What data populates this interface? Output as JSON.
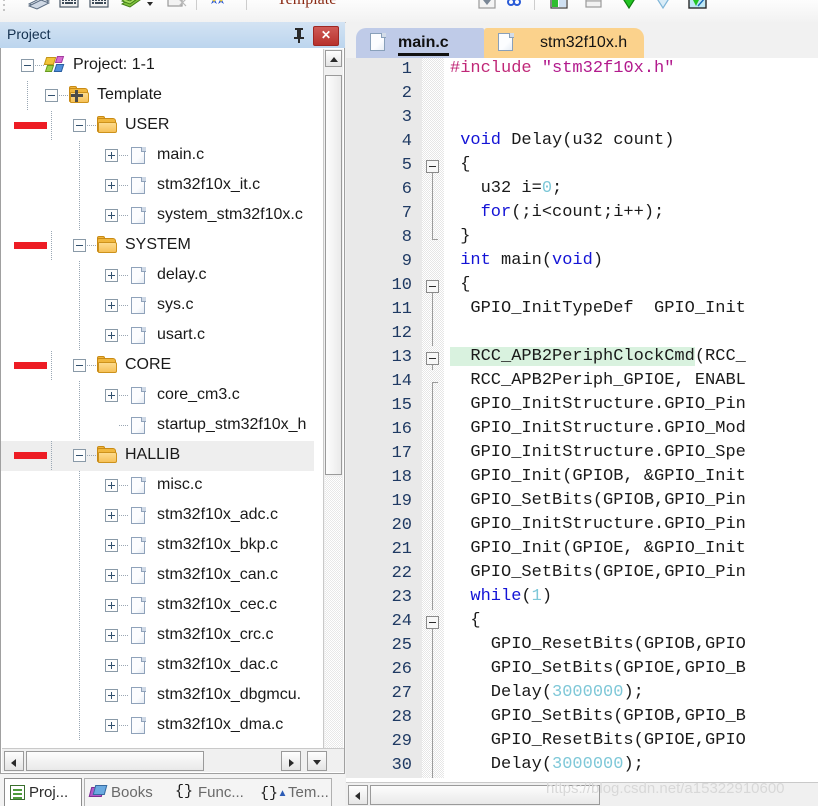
{
  "toolbar": {
    "template_label": "Template",
    "icons": [
      "books-icon",
      "keyboard-icon",
      "keyboard-icon-2",
      "build-icon",
      "clear-icon",
      "bookmark-icon",
      "dropdown-icon",
      "find-icon",
      "window-icon",
      "panel-icon",
      "download-icon",
      "filter-icon",
      "debug-icon"
    ]
  },
  "project_panel": {
    "title": "Project",
    "pin_label": "↯",
    "close_label": "✕",
    "tree": [
      {
        "label": "Project: 1-1",
        "depth": 0,
        "icon": "project-icon",
        "expander": "minus",
        "redmark": false,
        "selected": false
      },
      {
        "label": "Template",
        "depth": 1,
        "icon": "folder-icon",
        "expander": "minus",
        "redmark": false,
        "selected": false
      },
      {
        "label": "USER",
        "depth": 2,
        "icon": "folder-icon",
        "expander": "minus",
        "redmark": true,
        "selected": false
      },
      {
        "label": "main.c",
        "depth": 3,
        "icon": "file-icon",
        "expander": "plus",
        "redmark": false,
        "selected": false
      },
      {
        "label": "stm32f10x_it.c",
        "depth": 3,
        "icon": "file-icon",
        "expander": "plus",
        "redmark": false,
        "selected": false
      },
      {
        "label": "system_stm32f10x.c",
        "depth": 3,
        "icon": "file-icon",
        "expander": "plus",
        "redmark": false,
        "selected": false
      },
      {
        "label": "SYSTEM",
        "depth": 2,
        "icon": "folder-icon",
        "expander": "minus",
        "redmark": true,
        "selected": false
      },
      {
        "label": "delay.c",
        "depth": 3,
        "icon": "file-icon",
        "expander": "plus",
        "redmark": false,
        "selected": false
      },
      {
        "label": "sys.c",
        "depth": 3,
        "icon": "file-icon",
        "expander": "plus",
        "redmark": false,
        "selected": false
      },
      {
        "label": "usart.c",
        "depth": 3,
        "icon": "file-icon",
        "expander": "plus",
        "redmark": false,
        "selected": false
      },
      {
        "label": "CORE",
        "depth": 2,
        "icon": "folder-icon",
        "expander": "minus",
        "redmark": true,
        "selected": false
      },
      {
        "label": "core_cm3.c",
        "depth": 3,
        "icon": "file-icon",
        "expander": "plus",
        "redmark": false,
        "selected": false
      },
      {
        "label": "startup_stm32f10x_h",
        "depth": 3,
        "icon": "file-icon",
        "expander": "none",
        "redmark": false,
        "selected": false
      },
      {
        "label": "HALLIB",
        "depth": 2,
        "icon": "folder-icon",
        "expander": "minus",
        "redmark": true,
        "selected": true
      },
      {
        "label": "misc.c",
        "depth": 3,
        "icon": "file-icon",
        "expander": "plus",
        "redmark": false,
        "selected": false
      },
      {
        "label": "stm32f10x_adc.c",
        "depth": 3,
        "icon": "file-icon",
        "expander": "plus",
        "redmark": false,
        "selected": false
      },
      {
        "label": "stm32f10x_bkp.c",
        "depth": 3,
        "icon": "file-icon",
        "expander": "plus",
        "redmark": false,
        "selected": false
      },
      {
        "label": "stm32f10x_can.c",
        "depth": 3,
        "icon": "file-icon",
        "expander": "plus",
        "redmark": false,
        "selected": false
      },
      {
        "label": "stm32f10x_cec.c",
        "depth": 3,
        "icon": "file-icon",
        "expander": "plus",
        "redmark": false,
        "selected": false
      },
      {
        "label": "stm32f10x_crc.c",
        "depth": 3,
        "icon": "file-icon",
        "expander": "plus",
        "redmark": false,
        "selected": false
      },
      {
        "label": "stm32f10x_dac.c",
        "depth": 3,
        "icon": "file-icon",
        "expander": "plus",
        "redmark": false,
        "selected": false
      },
      {
        "label": "stm32f10x_dbgmcu.",
        "depth": 3,
        "icon": "file-icon",
        "expander": "plus",
        "redmark": false,
        "selected": false
      },
      {
        "label": "stm32f10x_dma.c",
        "depth": 3,
        "icon": "file-icon",
        "expander": "plus",
        "redmark": false,
        "selected": false
      }
    ]
  },
  "bottom_tabs": [
    {
      "label": "Proj...",
      "icon": "project-window-icon",
      "active": true
    },
    {
      "label": "Books",
      "icon": "books-icon",
      "active": false
    },
    {
      "label": "Func...",
      "icon": "braces-icon",
      "active": false
    },
    {
      "label": "Tem...",
      "icon": "templates-icon",
      "active": false
    }
  ],
  "editor": {
    "tabs": [
      {
        "label": "main.c",
        "active": true,
        "color": "#bfcbe8"
      },
      {
        "label": "stm32f10x.h",
        "active": false,
        "color": "#fbd28c"
      }
    ],
    "lines": [
      {
        "n": "1",
        "segments": [
          {
            "t": "#include ",
            "c": "pp"
          },
          {
            "t": "\"stm32f10x.h\"",
            "c": "str"
          }
        ],
        "fold": "none",
        "highlight": false
      },
      {
        "n": "2",
        "segments": [
          {
            "t": "",
            "c": ""
          }
        ],
        "fold": "none",
        "highlight": false
      },
      {
        "n": "3",
        "segments": [
          {
            "t": "",
            "c": ""
          }
        ],
        "fold": "none",
        "highlight": false
      },
      {
        "n": "4",
        "segments": [
          {
            "t": " ",
            "c": ""
          },
          {
            "t": "void",
            "c": "kw"
          },
          {
            "t": " Delay(u32 count)",
            "c": ""
          }
        ],
        "fold": "none",
        "highlight": false
      },
      {
        "n": "5",
        "segments": [
          {
            "t": " {",
            "c": ""
          }
        ],
        "fold": "start",
        "highlight": false
      },
      {
        "n": "6",
        "segments": [
          {
            "t": "   u32 i=",
            "c": ""
          },
          {
            "t": "0",
            "c": "num"
          },
          {
            "t": ";",
            "c": ""
          }
        ],
        "fold": "bar",
        "highlight": false
      },
      {
        "n": "7",
        "segments": [
          {
            "t": "   ",
            "c": ""
          },
          {
            "t": "for",
            "c": "kw"
          },
          {
            "t": "(;i<count;i++);",
            "c": ""
          }
        ],
        "fold": "bar",
        "highlight": false
      },
      {
        "n": "8",
        "segments": [
          {
            "t": " }",
            "c": ""
          }
        ],
        "fold": "end",
        "highlight": false
      },
      {
        "n": "9",
        "segments": [
          {
            "t": " ",
            "c": ""
          },
          {
            "t": "int",
            "c": "kw"
          },
          {
            "t": " main(",
            "c": ""
          },
          {
            "t": "void",
            "c": "kw"
          },
          {
            "t": ")",
            "c": ""
          }
        ],
        "fold": "none",
        "highlight": false
      },
      {
        "n": "10",
        "segments": [
          {
            "t": " {",
            "c": ""
          }
        ],
        "fold": "start",
        "highlight": false
      },
      {
        "n": "11",
        "segments": [
          {
            "t": "  GPIO_InitTypeDef  GPIO_Init",
            "c": ""
          }
        ],
        "fold": "bar",
        "highlight": false
      },
      {
        "n": "12",
        "segments": [
          {
            "t": "",
            "c": ""
          }
        ],
        "fold": "bar",
        "highlight": false
      },
      {
        "n": "13",
        "segments": [
          {
            "t": "  RCC_APB2PeriphClockCmd",
            "c": "hl"
          },
          {
            "t": "(RCC_",
            "c": ""
          }
        ],
        "fold": "start2",
        "highlight": true
      },
      {
        "n": "14",
        "segments": [
          {
            "t": "  RCC_APB2Periph_GPIOE, ENABL",
            "c": ""
          }
        ],
        "fold": "tick",
        "highlight": false
      },
      {
        "n": "15",
        "segments": [
          {
            "t": "  GPIO_InitStructure.GPIO_Pin",
            "c": ""
          }
        ],
        "fold": "bar",
        "highlight": false
      },
      {
        "n": "16",
        "segments": [
          {
            "t": "  GPIO_InitStructure.GPIO_Mod",
            "c": ""
          }
        ],
        "fold": "bar",
        "highlight": false
      },
      {
        "n": "17",
        "segments": [
          {
            "t": "  GPIO_InitStructure.GPIO_Spe",
            "c": ""
          }
        ],
        "fold": "bar",
        "highlight": false
      },
      {
        "n": "18",
        "segments": [
          {
            "t": "  GPIO_Init(GPIOB, &GPIO_Init",
            "c": ""
          }
        ],
        "fold": "bar",
        "highlight": false
      },
      {
        "n": "19",
        "segments": [
          {
            "t": "  GPIO_SetBits(GPIOB,GPIO_Pin",
            "c": ""
          }
        ],
        "fold": "bar",
        "highlight": false
      },
      {
        "n": "20",
        "segments": [
          {
            "t": "  GPIO_InitStructure.GPIO_Pin",
            "c": ""
          }
        ],
        "fold": "bar",
        "highlight": false
      },
      {
        "n": "21",
        "segments": [
          {
            "t": "  GPIO_Init(GPIOE, &GPIO_Init",
            "c": ""
          }
        ],
        "fold": "bar",
        "highlight": false
      },
      {
        "n": "22",
        "segments": [
          {
            "t": "  GPIO_SetBits(GPIOE,GPIO_Pin",
            "c": ""
          }
        ],
        "fold": "bar",
        "highlight": false
      },
      {
        "n": "23",
        "segments": [
          {
            "t": "  ",
            "c": ""
          },
          {
            "t": "while",
            "c": "kw"
          },
          {
            "t": "(",
            "c": ""
          },
          {
            "t": "1",
            "c": "num"
          },
          {
            "t": ")",
            "c": ""
          }
        ],
        "fold": "bar",
        "highlight": false
      },
      {
        "n": "24",
        "segments": [
          {
            "t": "  {",
            "c": ""
          }
        ],
        "fold": "start",
        "highlight": false
      },
      {
        "n": "25",
        "segments": [
          {
            "t": "    GPIO_ResetBits(GPIOB,GPIO",
            "c": ""
          }
        ],
        "fold": "bar",
        "highlight": false
      },
      {
        "n": "26",
        "segments": [
          {
            "t": "    GPIO_SetBits(GPIOE,GPIO_B",
            "c": ""
          }
        ],
        "fold": "bar",
        "highlight": false
      },
      {
        "n": "27",
        "segments": [
          {
            "t": "    Delay(",
            "c": ""
          },
          {
            "t": "3000000",
            "c": "num"
          },
          {
            "t": ");",
            "c": ""
          }
        ],
        "fold": "bar",
        "highlight": false
      },
      {
        "n": "28",
        "segments": [
          {
            "t": "    GPIO_SetBits(GPIOB,GPIO_B",
            "c": ""
          }
        ],
        "fold": "bar",
        "highlight": false
      },
      {
        "n": "29",
        "segments": [
          {
            "t": "    GPIO_ResetBits(GPIOE,GPIO",
            "c": ""
          }
        ],
        "fold": "bar",
        "highlight": false
      },
      {
        "n": "30",
        "segments": [
          {
            "t": "    Delay(",
            "c": ""
          },
          {
            "t": "3000000",
            "c": "num"
          },
          {
            "t": ");",
            "c": ""
          }
        ],
        "fold": "bar",
        "highlight": false
      }
    ]
  },
  "watermark": "https://blog.csdn.net/a15322910600",
  "colors": {
    "redmark": "#ed1c24",
    "tab_active": "#bfcbe8",
    "tab_header": "#fbd28c",
    "highlight": "#d9f2df",
    "keyword": "#1414d6",
    "preprocessor": "#c02878",
    "string": "#b21a8c",
    "number": "#7fc8d8"
  }
}
